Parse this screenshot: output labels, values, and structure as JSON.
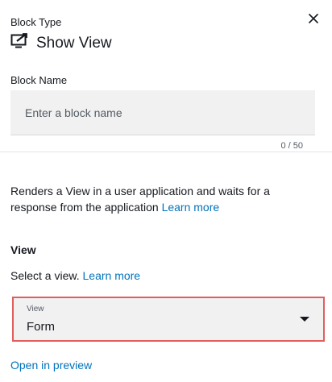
{
  "header": {
    "block_type_label": "Block Type",
    "title": "Show View",
    "title_icon": "show-view-icon",
    "close_icon": "close-icon"
  },
  "block_name": {
    "label": "Block Name",
    "value": "",
    "placeholder": "Enter a block name",
    "char_count": "0 / 50"
  },
  "description": {
    "text": "Renders a View in a user application and waits for a response from the application",
    "link_text": "Learn more"
  },
  "view": {
    "heading": "View",
    "prompt_text": "Select a view.",
    "prompt_link": "Learn more",
    "select_label": "View",
    "select_value": "Form",
    "highlight_color": "#e35d5d"
  },
  "footer": {
    "preview_link": "Open in preview"
  },
  "colors": {
    "link": "#0073bb",
    "text": "#16191f",
    "input_bg": "#f1f1f1"
  }
}
